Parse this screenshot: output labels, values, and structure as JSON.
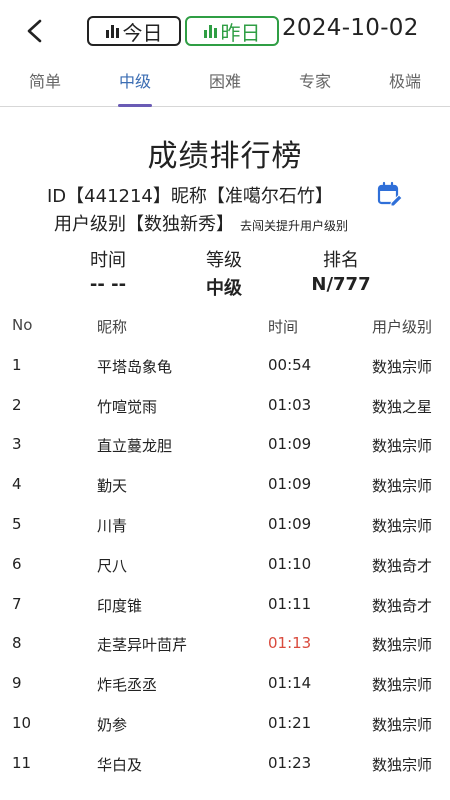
{
  "header": {
    "today_label": "今日",
    "yesterday_label": "昨日",
    "date": "2024-10-02",
    "colors": {
      "today": "#222222",
      "yesterday": "#2f9e44"
    }
  },
  "tabs": [
    {
      "label": "简单",
      "active": false
    },
    {
      "label": "中级",
      "active": true
    },
    {
      "label": "困难",
      "active": false
    },
    {
      "label": "专家",
      "active": false
    },
    {
      "label": "极端",
      "active": false
    }
  ],
  "title": "成绩排行榜",
  "user": {
    "id_line": "ID【441214】昵称【准噶尔石竹】",
    "level_line": "用户级别【数独新秀】",
    "upgrade_link": "去闯关提升用户级别"
  },
  "stats": {
    "time_label": "时间",
    "time_value": "-- --",
    "grade_label": "等级",
    "grade_value": "中级",
    "rank_label": "排名",
    "rank_value": "N/777"
  },
  "table": {
    "headers": [
      "No",
      "昵称",
      "时间",
      "用户级别"
    ],
    "rows": [
      {
        "no": "1",
        "name": "平塔岛象龟",
        "time": "00:54",
        "level": "数独宗师",
        "highlight": false
      },
      {
        "no": "2",
        "name": "竹喧觉雨",
        "time": "01:03",
        "level": "数独之星",
        "highlight": false
      },
      {
        "no": "3",
        "name": "直立蔓龙胆",
        "time": "01:09",
        "level": "数独宗师",
        "highlight": false
      },
      {
        "no": "4",
        "name": "勤天",
        "time": "01:09",
        "level": "数独宗师",
        "highlight": false
      },
      {
        "no": "5",
        "name": "川青",
        "time": "01:09",
        "level": "数独宗师",
        "highlight": false
      },
      {
        "no": "6",
        "name": "尺八",
        "time": "01:10",
        "level": "数独奇才",
        "highlight": false
      },
      {
        "no": "7",
        "name": "印度锥",
        "time": "01:11",
        "level": "数独奇才",
        "highlight": false
      },
      {
        "no": "8",
        "name": "走茎异叶茴芹",
        "time": "01:13",
        "level": "数独宗师",
        "highlight": true
      },
      {
        "no": "9",
        "name": "炸毛丞丞",
        "time": "01:14",
        "level": "数独宗师",
        "highlight": false
      },
      {
        "no": "10",
        "name": "奶参",
        "time": "01:21",
        "level": "数独宗师",
        "highlight": false
      },
      {
        "no": "11",
        "name": "华白及",
        "time": "01:23",
        "level": "数独宗师",
        "highlight": false
      }
    ],
    "highlight_color": "#d94a3d"
  }
}
